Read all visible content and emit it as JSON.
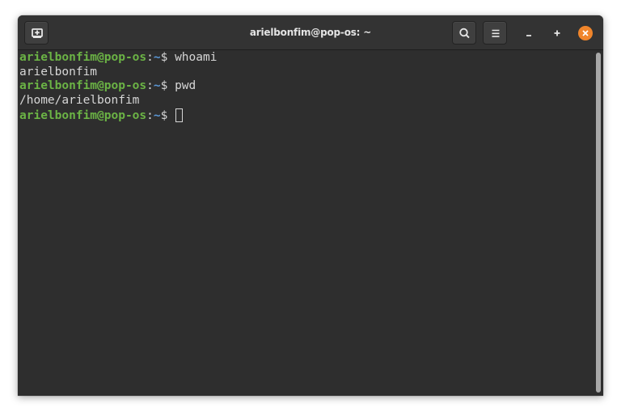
{
  "window": {
    "title": "arielbonfim@pop-os: ~"
  },
  "headerbar": {
    "new_tab_icon": "new-tab-icon",
    "search_icon": "search-icon",
    "menu_icon": "hamburger-menu-icon",
    "minimize_icon": "minimize-icon",
    "maximize_icon": "maximize-icon",
    "close_icon": "close-icon"
  },
  "terminal": {
    "lines": [
      {
        "user_host": "arielbonfim@pop-os",
        "colon": ":",
        "path": "~",
        "symbol": "$ ",
        "command": "whoami"
      },
      {
        "output": "arielbonfim"
      },
      {
        "user_host": "arielbonfim@pop-os",
        "colon": ":",
        "path": "~",
        "symbol": "$ ",
        "command": "pwd"
      },
      {
        "output": "/home/arielbonfim"
      },
      {
        "user_host": "arielbonfim@pop-os",
        "colon": ":",
        "path": "~",
        "symbol": "$ ",
        "command": ""
      }
    ]
  },
  "colors": {
    "prompt_user": "#6bb345",
    "prompt_path": "#5a97d6",
    "text": "#d6d6d6",
    "background": "#2e2e2e",
    "close_button": "#f0852b"
  }
}
